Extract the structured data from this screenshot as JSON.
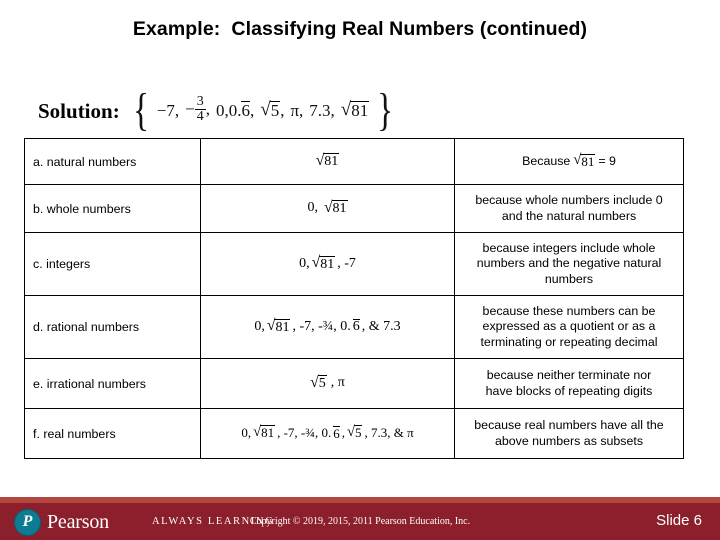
{
  "slide": {
    "title": "Example:  Classifying Real Numbers (continued)",
    "solution_label": "Solution:",
    "solution_set": {
      "open_brace": "{",
      "close_brace": "}",
      "items_text": "−7, −3/4, 0, 0.6̅, √5, π, 7.3, √81",
      "item_1": "−7,",
      "item_2_sign": "−",
      "item_2_num": "3",
      "item_2_den": "4",
      "item_2_comma": ",",
      "item_3": "0,0.",
      "item_3_repeat": "6",
      "item_3_comma": ",",
      "item_4_radicand": "5",
      "item_4_comma": ",",
      "item_5": "π,",
      "item_6": "7.3,",
      "item_7_radicand": "81"
    }
  },
  "table": {
    "rows": [
      {
        "label": "a. natural numbers",
        "members_prefix": "",
        "members_radicand": "81",
        "members_suffix": "",
        "reason_prefix": "Because",
        "reason_radicand": "81",
        "reason_suffix": "= 9",
        "reason_lines": [
          "Because √81 = 9"
        ]
      },
      {
        "label": "b. whole numbers",
        "members_prefix": "0,",
        "members_radicand": "81",
        "members_suffix": "",
        "reason_lines": [
          "because whole numbers include 0",
          "and the natural numbers"
        ]
      },
      {
        "label": "c. integers",
        "members_prefix": "0,",
        "members_radicand": "81",
        "members_suffix": ", -7",
        "reason_lines": [
          "because integers include whole",
          "numbers and the negative natural",
          "numbers"
        ]
      },
      {
        "label": "d. rational numbers",
        "members_prefix": "0,",
        "members_radicand": "81",
        "members_mid": ", -7, -¾, 0.",
        "members_repeat": "6",
        "members_suffix": ", & 7.3",
        "reason_lines": [
          "because these numbers can be",
          "expressed as a quotient or as a",
          "terminating or repeating decimal"
        ]
      },
      {
        "label": "e. irrational numbers",
        "members_prefix": "",
        "members_radicand": "5",
        "members_suffix": ", π",
        "reason_lines": [
          "because neither terminate nor",
          "have blocks of repeating digits"
        ]
      },
      {
        "label": "f. real numbers",
        "members_prefix": "0,",
        "members_radicand": "81",
        "members_mid": ", -7, -¾, 0.",
        "members_repeat": "6",
        "members_radicand2": "5",
        "members_suffix": ", 7.3, & π",
        "reason_lines": [
          "because real numbers have all the",
          "above numbers as subsets"
        ]
      }
    ]
  },
  "footer": {
    "logo_letter": "P",
    "logo_word": "Pearson",
    "tagline": "ALWAYS LEARNING",
    "copyright": "Copyright © 2019, 2015, 2011 Pearson Education, Inc.",
    "slide_number": "Slide 6",
    "bar_color": "#8B1F2B",
    "stripe_color": "#B4473F",
    "logo_circle_color": "#0D7C93"
  }
}
